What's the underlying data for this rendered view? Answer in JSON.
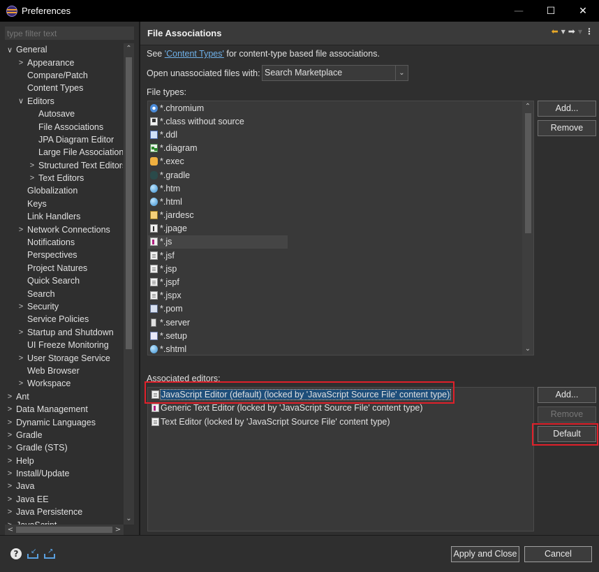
{
  "window": {
    "title": "Preferences",
    "minimize": "—",
    "maximize": "☐",
    "close": "✕"
  },
  "sidebar": {
    "filter_placeholder": "type filter text",
    "items": [
      {
        "label": "General",
        "twisty": "∨",
        "indent": 0
      },
      {
        "label": "Appearance",
        "twisty": ">",
        "indent": 1
      },
      {
        "label": "Compare/Patch",
        "twisty": "",
        "indent": 1
      },
      {
        "label": "Content Types",
        "twisty": "",
        "indent": 1
      },
      {
        "label": "Editors",
        "twisty": "∨",
        "indent": 1
      },
      {
        "label": "Autosave",
        "twisty": "",
        "indent": 2
      },
      {
        "label": "File Associations",
        "twisty": "",
        "indent": 2
      },
      {
        "label": "JPA Diagram Editor",
        "twisty": "",
        "indent": 2
      },
      {
        "label": "Large File Associations",
        "twisty": "",
        "indent": 2
      },
      {
        "label": "Structured Text Editors",
        "twisty": ">",
        "indent": 2
      },
      {
        "label": "Text Editors",
        "twisty": ">",
        "indent": 2
      },
      {
        "label": "Globalization",
        "twisty": "",
        "indent": 1
      },
      {
        "label": "Keys",
        "twisty": "",
        "indent": 1
      },
      {
        "label": "Link Handlers",
        "twisty": "",
        "indent": 1
      },
      {
        "label": "Network Connections",
        "twisty": ">",
        "indent": 1
      },
      {
        "label": "Notifications",
        "twisty": "",
        "indent": 1
      },
      {
        "label": "Perspectives",
        "twisty": "",
        "indent": 1
      },
      {
        "label": "Project Natures",
        "twisty": "",
        "indent": 1
      },
      {
        "label": "Quick Search",
        "twisty": "",
        "indent": 1
      },
      {
        "label": "Search",
        "twisty": "",
        "indent": 1
      },
      {
        "label": "Security",
        "twisty": ">",
        "indent": 1
      },
      {
        "label": "Service Policies",
        "twisty": "",
        "indent": 1
      },
      {
        "label": "Startup and Shutdown",
        "twisty": ">",
        "indent": 1
      },
      {
        "label": "UI Freeze Monitoring",
        "twisty": "",
        "indent": 1
      },
      {
        "label": "User Storage Service",
        "twisty": ">",
        "indent": 1
      },
      {
        "label": "Web Browser",
        "twisty": "",
        "indent": 1
      },
      {
        "label": "Workspace",
        "twisty": ">",
        "indent": 1
      },
      {
        "label": "Ant",
        "twisty": ">",
        "indent": 0
      },
      {
        "label": "Data Management",
        "twisty": ">",
        "indent": 0
      },
      {
        "label": "Dynamic Languages",
        "twisty": ">",
        "indent": 0
      },
      {
        "label": "Gradle",
        "twisty": ">",
        "indent": 0
      },
      {
        "label": "Gradle (STS)",
        "twisty": ">",
        "indent": 0
      },
      {
        "label": "Help",
        "twisty": ">",
        "indent": 0
      },
      {
        "label": "Install/Update",
        "twisty": ">",
        "indent": 0
      },
      {
        "label": "Java",
        "twisty": ">",
        "indent": 0
      },
      {
        "label": "Java EE",
        "twisty": ">",
        "indent": 0
      },
      {
        "label": "Java Persistence",
        "twisty": ">",
        "indent": 0
      },
      {
        "label": "JavaScript",
        "twisty": ">",
        "indent": 0
      }
    ]
  },
  "page": {
    "title": "File Associations",
    "see_prefix": "See ",
    "see_link": "'Content Types'",
    "see_suffix": " for content-type based file associations.",
    "open_label": "Open unassociated files with:",
    "open_value": "Search Marketplace",
    "file_types_label": "File types:",
    "file_types": [
      {
        "name": "*.chromium",
        "icon": "chrom"
      },
      {
        "name": "*.class without source",
        "icon": "cls"
      },
      {
        "name": "*.ddl",
        "icon": "ddl"
      },
      {
        "name": "*.diagram",
        "icon": "diag"
      },
      {
        "name": "*.exec",
        "icon": "exec"
      },
      {
        "name": "*.gradle",
        "icon": "gradle"
      },
      {
        "name": "*.htm",
        "icon": "globe"
      },
      {
        "name": "*.html",
        "icon": "globe"
      },
      {
        "name": "*.jardesc",
        "icon": "jar"
      },
      {
        "name": "*.jpage",
        "icon": "jpage"
      },
      {
        "name": "*.js",
        "icon": "js"
      },
      {
        "name": "*.jsf",
        "icon": "doc"
      },
      {
        "name": "*.jsp",
        "icon": "doc"
      },
      {
        "name": "*.jspf",
        "icon": "doc"
      },
      {
        "name": "*.jspx",
        "icon": "doc"
      },
      {
        "name": "*.pom",
        "icon": "pom"
      },
      {
        "name": "*.server",
        "icon": "srv"
      },
      {
        "name": "*.setup",
        "icon": "setup"
      },
      {
        "name": "*.shtml",
        "icon": "globe"
      }
    ],
    "file_types_selected_index": 10,
    "ft_add": "Add...",
    "ft_remove": "Remove",
    "assoc_label": "Associated editors:",
    "editors": [
      {
        "name": "JavaScript Editor (default) (locked by 'JavaScript Source File' content type)",
        "icon": "doc"
      },
      {
        "name": "Generic Text Editor (locked by 'JavaScript Source File' content type)",
        "icon": "js"
      },
      {
        "name": "Text Editor (locked by 'JavaScript Source File' content type)",
        "icon": "doc"
      }
    ],
    "editors_selected_index": 0,
    "ae_add": "Add...",
    "ae_remove": "Remove",
    "ae_default": "Default"
  },
  "footer": {
    "apply_close": "Apply and Close",
    "cancel": "Cancel"
  }
}
